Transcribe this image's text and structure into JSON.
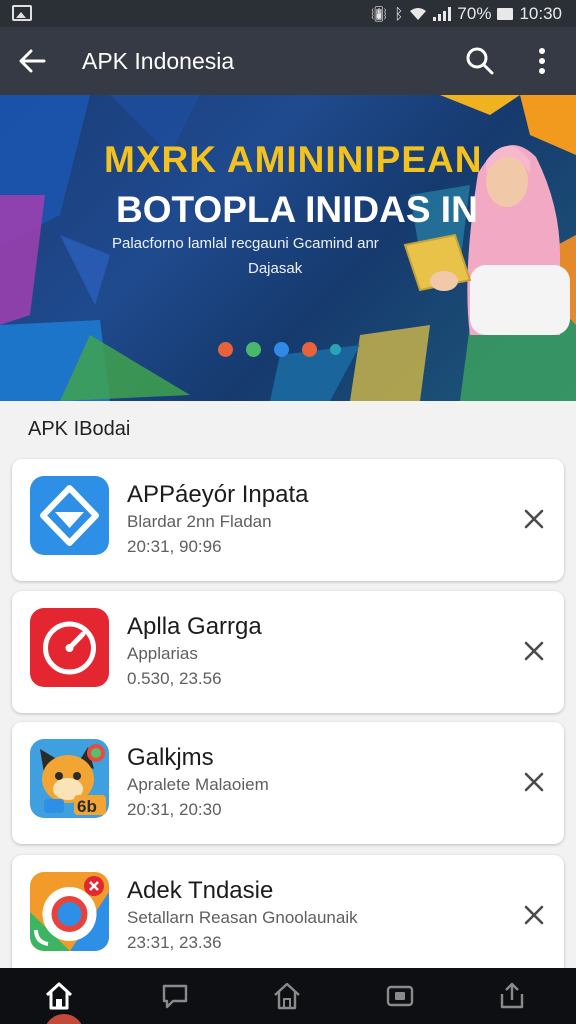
{
  "status_bar": {
    "battery_text": "70%",
    "time": "10:30",
    "icons": [
      "gallery-icon",
      "vibrate-icon",
      "bluetooth-icon",
      "wifi-icon",
      "signal-icon",
      "battery-icon"
    ]
  },
  "app_bar": {
    "title": "APK Indonesia",
    "icons": [
      "back-arrow-icon",
      "search-icon",
      "more-vert-icon"
    ]
  },
  "banner": {
    "headline_line1": "MXRK AMININIPEAN",
    "headline_line2": "BOTOPLA INIDAS IN",
    "subtitle_line1": "Palacforno lamlal recgauni Gcamind anr",
    "subtitle_line2": "Dajasak",
    "dot_colors": [
      "#e8623a",
      "#49b86b",
      "#2e8ae6",
      "#e8623a",
      "#2aa3b8"
    ],
    "active_dot": 2
  },
  "section": {
    "title": "APK IBodai"
  },
  "apps": [
    {
      "name": "APPáeyór Inpata",
      "subtitle": "Blardar 2nn Fladan",
      "meta": "20:31, 90:96",
      "icon": "blue-shield-app-icon"
    },
    {
      "name": "Aplla Garrga",
      "subtitle": "Applarias",
      "meta": "0.530, 23.56",
      "icon": "red-timer-app-icon"
    },
    {
      "name": "Galkjms",
      "subtitle": "Apralete Malaoiem",
      "meta": "20:31, 20:30",
      "icon": "cartoon-fox-game-icon"
    },
    {
      "name": "Adek Tndasie",
      "subtitle": "Setallarn Reasan Gnoolaunaik",
      "meta": "23:31, 23.36",
      "icon": "chrome-like-app-icon"
    }
  ],
  "bottom_nav": {
    "items": [
      "home-icon",
      "chat-icon",
      "house-icon",
      "tv-icon",
      "share-icon"
    ],
    "active": 0
  },
  "colors": {
    "app_bar": "#353a44",
    "status_bar": "#2b2f36",
    "banner_bg": "#1a3c78",
    "headline_yellow": "#f4c21e",
    "bottom_nav": "#0e0f12"
  }
}
